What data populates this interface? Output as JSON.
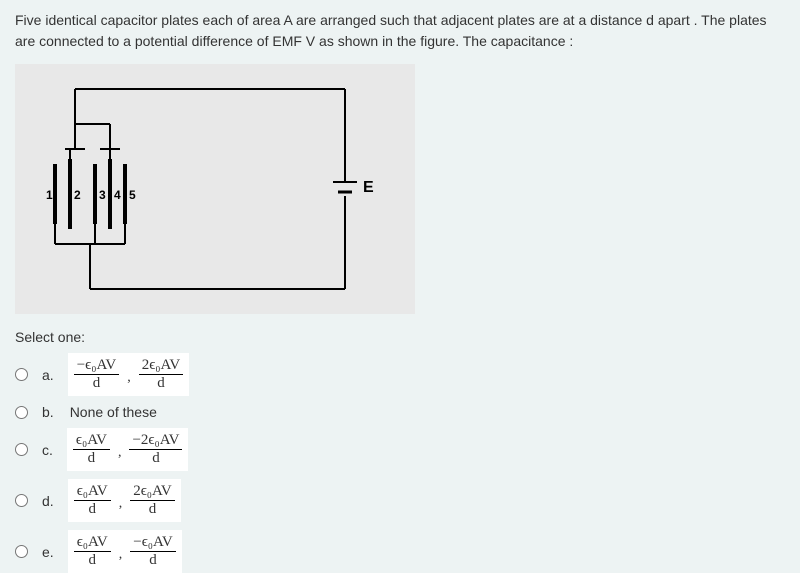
{
  "question": "Five identical capacitor plates each of area A are arranged such that adjacent plates are at a distance d apart . The plates are connected to a potential difference of EMF V as shown in the figure. The capacitance :",
  "figure": {
    "plate_labels": [
      "1",
      "2",
      "3",
      "4",
      "5"
    ],
    "emf_label": "E"
  },
  "select_label": "Select one:",
  "options": {
    "a": {
      "letter": "a.",
      "frac1_num": "−ϵ₀AV",
      "frac1_den": "d",
      "frac2_num": "2ϵ₀AV",
      "frac2_den": "d"
    },
    "b": {
      "letter": "b.",
      "text": "None of these"
    },
    "c": {
      "letter": "c.",
      "frac1_num": "ϵ₀AV",
      "frac1_den": "d",
      "frac2_num": "−2ϵ₀AV",
      "frac2_den": "d"
    },
    "d": {
      "letter": "d.",
      "frac1_num": "ϵ₀AV",
      "frac1_den": "d",
      "frac2_num": "2ϵ₀AV",
      "frac2_den": "d"
    },
    "e": {
      "letter": "e.",
      "frac1_num": "ϵ₀AV",
      "frac1_den": "d",
      "frac2_num": "−ϵ₀AV",
      "frac2_den": "d"
    }
  }
}
